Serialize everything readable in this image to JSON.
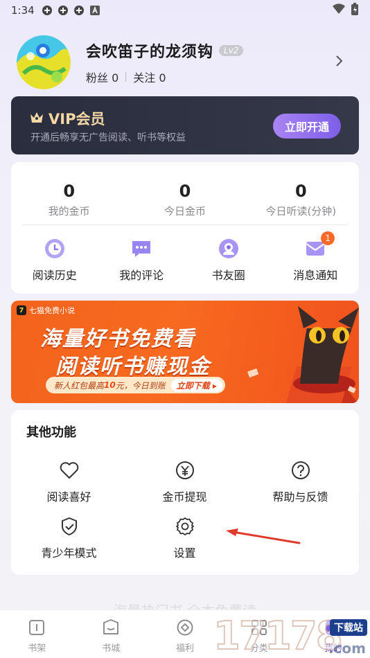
{
  "status_bar": {
    "time": "1:34"
  },
  "profile": {
    "nickname": "会吹笛子的龙须钩",
    "level": "Lv2",
    "fans_label": "粉丝",
    "fans_count": "0",
    "following_label": "关注",
    "following_count": "0"
  },
  "vip": {
    "title": "VIP会员",
    "subtitle": "开通后畅享无广告阅读、听书等权益",
    "button": "立即开通"
  },
  "stats": [
    {
      "value": "0",
      "label": "我的金币"
    },
    {
      "value": "0",
      "label": "今日金币"
    },
    {
      "value": "0",
      "label": "今日听读(分钟)"
    }
  ],
  "quick_actions": [
    {
      "label": "阅读历史",
      "icon": "clock-icon"
    },
    {
      "label": "我的评论",
      "icon": "comment-icon"
    },
    {
      "label": "书友圈",
      "icon": "circle-icon"
    },
    {
      "label": "消息通知",
      "icon": "mail-icon",
      "badge": "1"
    }
  ],
  "banner": {
    "brand": "七猫免费小说",
    "logo_char": "7",
    "line1": "海量好书免费看",
    "line2": "阅读听书赚现金",
    "pill_prefix": "新人红包最高",
    "pill_amount": "10",
    "pill_suffix": "元，今日到账",
    "cta": "立即下载 ▸"
  },
  "other": {
    "title": "其他功能",
    "features": [
      {
        "label": "阅读喜好",
        "icon": "heart-icon"
      },
      {
        "label": "金币提现",
        "icon": "yen-icon"
      },
      {
        "label": "帮助与反馈",
        "icon": "help-icon"
      },
      {
        "label": "青少年模式",
        "icon": "shield-check-icon"
      },
      {
        "label": "设置",
        "icon": "gear-icon"
      }
    ]
  },
  "hint": "海量热门书 全本免费读",
  "bottom_nav": [
    {
      "label": "书架",
      "icon": "bookshelf-icon"
    },
    {
      "label": "书城",
      "icon": "bookstore-icon"
    },
    {
      "label": "福利",
      "icon": "welfare-icon"
    },
    {
      "label": "分类",
      "icon": "category-icon"
    },
    {
      "label": "我的",
      "icon": "profile-icon"
    }
  ],
  "watermark": {
    "digits": "17178",
    "tag": "下载站",
    "domain": ".com"
  },
  "colors": {
    "accent": "#7b5ce6",
    "vip_gold": "#f3d7a4",
    "banner_orange": "#f3631c",
    "badge": "#ff6a2a"
  }
}
